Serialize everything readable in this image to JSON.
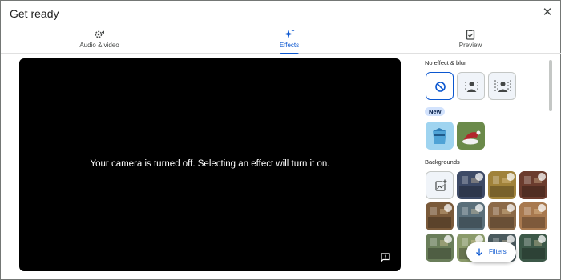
{
  "dialog": {
    "title": "Get ready"
  },
  "tabs": [
    {
      "label": "Audio & video",
      "icon": "gear-video-icon"
    },
    {
      "label": "Effects",
      "icon": "sparkle-icon",
      "active": true
    },
    {
      "label": "Preview",
      "icon": "clipboard-check-icon"
    }
  ],
  "video": {
    "message": "Your camera is turned off. Selecting an effect will turn it on.",
    "feedback_icon": "feedback-icon"
  },
  "effects": {
    "no_effect_title": "No effect & blur",
    "blur_options": [
      {
        "name": "no-effect",
        "icon": "no-effect-icon",
        "selected": true
      },
      {
        "name": "slight-blur",
        "icon": "slight-blur-icon"
      },
      {
        "name": "blur",
        "icon": "blur-icon"
      }
    ],
    "new_badge": "New",
    "new_items": [
      {
        "name": "new-effect-1",
        "color": "#4fa3d6"
      },
      {
        "name": "new-effect-2",
        "color": "#5a7a3a"
      }
    ],
    "backgrounds_title": "Backgrounds",
    "add_background_icon": "add-image-icon",
    "background_colors": [
      "#3d4a66",
      "#a0823a",
      "#6b3c2e",
      "#7a5a3a",
      "#5a6f7a",
      "#8c6a48",
      "#a8794f",
      "#6a7e5a",
      "#8a9a6a",
      "#4a5a5e",
      "#3c5848"
    ]
  },
  "filters": {
    "label": "Filters"
  },
  "colors": {
    "accent": "#0b57d0",
    "badge_bg": "#d3e3fd"
  }
}
